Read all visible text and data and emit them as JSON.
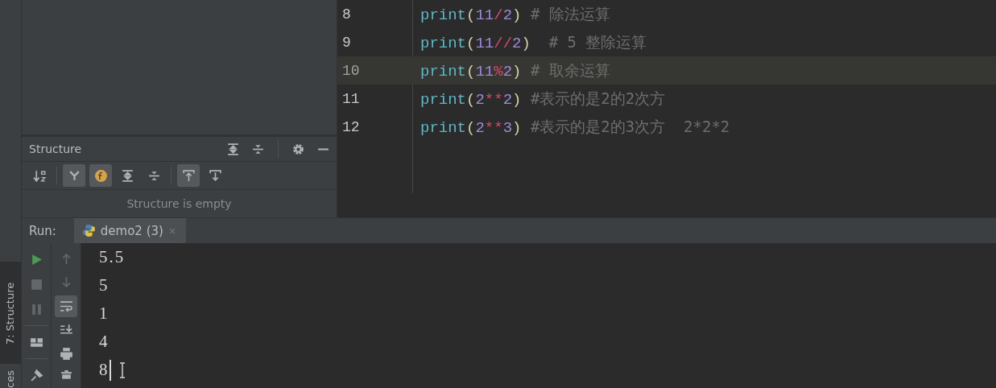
{
  "side_tabs": [
    {
      "label": "7: Structure",
      "selected": true
    },
    {
      "label": "ces",
      "selected": false
    }
  ],
  "structure": {
    "title": "Structure",
    "header_tools": [
      {
        "kind": "expand"
      },
      {
        "kind": "collapse"
      },
      {
        "kind": "gear"
      },
      {
        "kind": "minimize"
      }
    ],
    "tools": [
      {
        "kind": "sort",
        "on": false
      },
      {
        "kind": "fields",
        "on": true
      },
      {
        "kind": "func",
        "on": true
      },
      {
        "kind": "expand",
        "on": false
      },
      {
        "kind": "collapse",
        "on": false
      },
      {
        "kind": "scroll-to",
        "on": true
      },
      {
        "kind": "scroll-from",
        "on": false
      }
    ],
    "empty_text": "Structure is empty"
  },
  "editor": {
    "lines": [
      {
        "number": "8",
        "current": false,
        "tokens": [
          {
            "kind": "fn",
            "text": "print"
          },
          {
            "kind": "paren",
            "text": "("
          },
          {
            "kind": "num",
            "text": "11"
          },
          {
            "kind": "op",
            "text": "/"
          },
          {
            "kind": "num",
            "text": "2"
          },
          {
            "kind": "paren",
            "text": ")"
          },
          {
            "kind": "comment",
            "text": " # 除法运算"
          }
        ]
      },
      {
        "number": "9",
        "current": false,
        "tokens": [
          {
            "kind": "fn",
            "text": "print"
          },
          {
            "kind": "paren",
            "text": "("
          },
          {
            "kind": "num",
            "text": "11"
          },
          {
            "kind": "op",
            "text": "//"
          },
          {
            "kind": "num",
            "text": "2"
          },
          {
            "kind": "paren",
            "text": ")"
          },
          {
            "kind": "comment",
            "text": "  # 5 整除运算"
          }
        ]
      },
      {
        "number": "10",
        "current": true,
        "tokens": [
          {
            "kind": "fn",
            "text": "print"
          },
          {
            "kind": "paren",
            "text": "("
          },
          {
            "kind": "num",
            "text": "11"
          },
          {
            "kind": "op",
            "text": "%"
          },
          {
            "kind": "num",
            "text": "2"
          },
          {
            "kind": "paren",
            "text": ")"
          },
          {
            "kind": "comment",
            "text": " # 取余运算"
          }
        ]
      },
      {
        "number": "11",
        "current": false,
        "tokens": [
          {
            "kind": "fn",
            "text": "print"
          },
          {
            "kind": "paren",
            "text": "("
          },
          {
            "kind": "num",
            "text": "2"
          },
          {
            "kind": "op",
            "text": "**"
          },
          {
            "kind": "num",
            "text": "2"
          },
          {
            "kind": "paren",
            "text": ")"
          },
          {
            "kind": "comment",
            "text": " #表示的是2的2次方"
          }
        ]
      },
      {
        "number": "12",
        "current": false,
        "tokens": [
          {
            "kind": "fn",
            "text": "print"
          },
          {
            "kind": "paren",
            "text": "("
          },
          {
            "kind": "num",
            "text": "2"
          },
          {
            "kind": "op",
            "text": "**"
          },
          {
            "kind": "num",
            "text": "3"
          },
          {
            "kind": "paren",
            "text": ")"
          },
          {
            "kind": "comment",
            "text": " #表示的是2的3次方  2*2*2"
          }
        ]
      }
    ]
  },
  "run": {
    "label": "Run:",
    "tab": {
      "title": "demo2 (3)",
      "selected": true
    },
    "toolbar_1": [
      {
        "kind": "rerun",
        "disabled": false
      },
      {
        "kind": "stop",
        "disabled": true
      },
      {
        "kind": "pause",
        "disabled": true
      },
      {
        "kind": "layout",
        "disabled": false
      },
      {
        "kind": "pin",
        "disabled": false
      }
    ],
    "toolbar_2": [
      {
        "kind": "up",
        "on": false,
        "disabled": true
      },
      {
        "kind": "down",
        "on": false,
        "disabled": true
      },
      {
        "kind": "wrap",
        "on": true,
        "disabled": false
      },
      {
        "kind": "scroll-end",
        "on": false,
        "disabled": false
      },
      {
        "kind": "print",
        "on": false,
        "disabled": false
      },
      {
        "kind": "trash",
        "on": false,
        "disabled": false
      }
    ],
    "output": [
      "5.5",
      "5",
      "1",
      "4",
      "8"
    ]
  }
}
